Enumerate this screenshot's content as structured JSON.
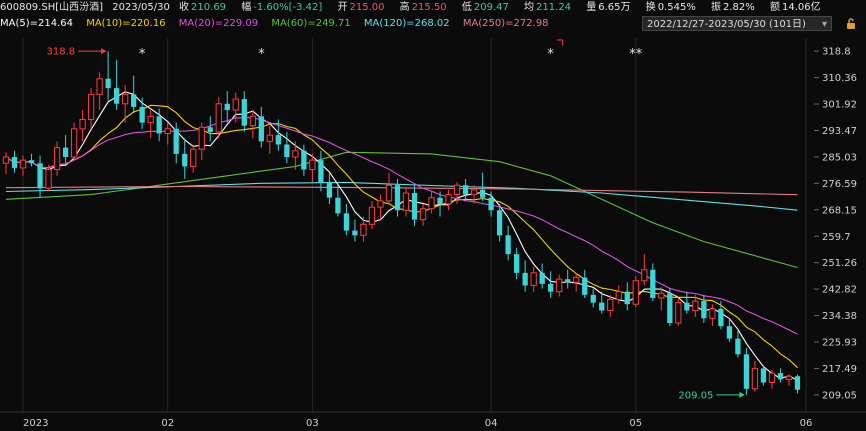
{
  "header": {
    "code": "600809.SH[山西汾酒]",
    "date": "2023/05/30",
    "close_label": "收",
    "close": "210.69",
    "chg_label": "幅",
    "chg": "-1.60%[-3.42]",
    "open_label": "开",
    "open": "215.00",
    "high_label": "高",
    "high": "215.50",
    "low_label": "低",
    "low": "209.47",
    "avg_label": "均",
    "avg": "211.24",
    "vol_label": "量",
    "vol": "6.65万",
    "turn_label": "换",
    "turn": "0.545%",
    "amp_label": "振",
    "amp": "2.82%",
    "amt_label": "额",
    "amt": "14.06亿"
  },
  "ma_legend": [
    {
      "label": "MA(5)=214.64",
      "color": "#ffffff"
    },
    {
      "label": "MA(10)=220.16",
      "color": "#f5d300"
    },
    {
      "label": "MA(20)=229.09",
      "color": "#e24fe6"
    },
    {
      "label": "MA(60)=249.71",
      "color": "#5cc23a"
    },
    {
      "label": "MA(120)=268.02",
      "color": "#61e0e6"
    },
    {
      "label": "MA(250)=272.98",
      "color": "#e87d7d"
    }
  ],
  "range_selector": {
    "label": "2022/12/27-2023/05/30 (101日)"
  },
  "chart_data": {
    "type": "candlestick",
    "y_ticks": [
      "318.8",
      "310.36",
      "301.92",
      "293.47",
      "285.03",
      "276.59",
      "268.15",
      "259.7",
      "251.26",
      "242.82",
      "234.38",
      "225.93",
      "217.49",
      "209.05"
    ],
    "ylim": [
      205.5,
      323.0
    ],
    "x_labels": [
      {
        "label": "2023",
        "i": 2
      },
      {
        "label": "02",
        "i": 19
      },
      {
        "label": "03",
        "i": 36
      },
      {
        "label": "04",
        "i": 57
      },
      {
        "label": "05",
        "i": 74
      },
      {
        "label": "06",
        "i": 94
      }
    ],
    "annotations": [
      {
        "text": "318.8",
        "i": 12,
        "price": 318.8,
        "side": "left",
        "color": "#ff4040"
      },
      {
        "text": "209.05",
        "i": 87,
        "price": 209.05,
        "side": "left",
        "color": "#3bd08c"
      }
    ],
    "markers": [
      {
        "text": "*",
        "i": 16
      },
      {
        "text": "*",
        "i": 30
      },
      {
        "text": "*",
        "i": 64
      },
      {
        "text": "**",
        "i": 74
      }
    ],
    "candles": [
      {
        "o": 283.0,
        "h": 286.5,
        "l": 279.5,
        "c": 285.0
      },
      {
        "o": 285.0,
        "h": 287.0,
        "l": 280.0,
        "c": 281.5
      },
      {
        "o": 281.5,
        "h": 285.5,
        "l": 279.0,
        "c": 284.0
      },
      {
        "o": 284.0,
        "h": 286.0,
        "l": 282.0,
        "c": 283.0
      },
      {
        "o": 283.0,
        "h": 285.5,
        "l": 272.0,
        "c": 275.0
      },
      {
        "o": 275.0,
        "h": 282.5,
        "l": 274.0,
        "c": 281.0
      },
      {
        "o": 281.0,
        "h": 290.0,
        "l": 279.0,
        "c": 288.0
      },
      {
        "o": 288.0,
        "h": 292.0,
        "l": 283.0,
        "c": 285.0
      },
      {
        "o": 285.0,
        "h": 296.0,
        "l": 284.0,
        "c": 294.0
      },
      {
        "o": 294.0,
        "h": 300.0,
        "l": 290.0,
        "c": 297.0
      },
      {
        "o": 297.0,
        "h": 307.0,
        "l": 294.0,
        "c": 305.0
      },
      {
        "o": 305.0,
        "h": 312.0,
        "l": 300.0,
        "c": 310.0
      },
      {
        "o": 310.0,
        "h": 318.8,
        "l": 303.0,
        "c": 307.0
      },
      {
        "o": 307.0,
        "h": 316.0,
        "l": 300.0,
        "c": 302.0
      },
      {
        "o": 302.0,
        "h": 308.0,
        "l": 296.0,
        "c": 305.0
      },
      {
        "o": 305.0,
        "h": 311.0,
        "l": 299.0,
        "c": 301.0
      },
      {
        "o": 301.0,
        "h": 304.0,
        "l": 294.0,
        "c": 296.0
      },
      {
        "o": 296.0,
        "h": 300.0,
        "l": 291.0,
        "c": 298.0
      },
      {
        "o": 298.0,
        "h": 300.5,
        "l": 290.0,
        "c": 292.5
      },
      {
        "o": 292.5,
        "h": 296.0,
        "l": 289.0,
        "c": 294.0
      },
      {
        "o": 294.0,
        "h": 296.0,
        "l": 283.0,
        "c": 286.0
      },
      {
        "o": 286.0,
        "h": 291.0,
        "l": 278.0,
        "c": 282.0
      },
      {
        "o": 282.0,
        "h": 289.0,
        "l": 280.0,
        "c": 287.5
      },
      {
        "o": 287.5,
        "h": 296.0,
        "l": 284.0,
        "c": 294.5
      },
      {
        "o": 294.5,
        "h": 298.0,
        "l": 290.0,
        "c": 293.0
      },
      {
        "o": 293.0,
        "h": 304.0,
        "l": 291.0,
        "c": 302.0
      },
      {
        "o": 302.0,
        "h": 306.0,
        "l": 296.0,
        "c": 300.0
      },
      {
        "o": 300.0,
        "h": 305.5,
        "l": 296.0,
        "c": 303.5
      },
      {
        "o": 303.5,
        "h": 306.0,
        "l": 293.0,
        "c": 295.0
      },
      {
        "o": 295.0,
        "h": 300.0,
        "l": 291.0,
        "c": 298.0
      },
      {
        "o": 298.0,
        "h": 301.0,
        "l": 288.0,
        "c": 290.0
      },
      {
        "o": 290.0,
        "h": 295.0,
        "l": 286.0,
        "c": 292.0
      },
      {
        "o": 292.0,
        "h": 297.0,
        "l": 287.0,
        "c": 289.0
      },
      {
        "o": 289.0,
        "h": 293.0,
        "l": 283.0,
        "c": 285.0
      },
      {
        "o": 285.0,
        "h": 290.0,
        "l": 281.0,
        "c": 287.0
      },
      {
        "o": 287.0,
        "h": 289.0,
        "l": 279.0,
        "c": 281.0
      },
      {
        "o": 281.0,
        "h": 286.0,
        "l": 277.0,
        "c": 284.0
      },
      {
        "o": 284.0,
        "h": 287.0,
        "l": 274.0,
        "c": 277.0
      },
      {
        "o": 277.0,
        "h": 280.0,
        "l": 270.0,
        "c": 272.0
      },
      {
        "o": 272.0,
        "h": 276.0,
        "l": 266.0,
        "c": 267.0
      },
      {
        "o": 267.0,
        "h": 270.0,
        "l": 260.0,
        "c": 261.5
      },
      {
        "o": 261.5,
        "h": 265.0,
        "l": 258.0,
        "c": 260.0
      },
      {
        "o": 260.0,
        "h": 266.0,
        "l": 258.0,
        "c": 263.5
      },
      {
        "o": 263.5,
        "h": 271.0,
        "l": 262.0,
        "c": 269.0
      },
      {
        "o": 269.0,
        "h": 273.0,
        "l": 265.0,
        "c": 271.0
      },
      {
        "o": 271.0,
        "h": 280.0,
        "l": 270.0,
        "c": 276.0
      },
      {
        "o": 276.0,
        "h": 278.0,
        "l": 266.0,
        "c": 268.0
      },
      {
        "o": 268.0,
        "h": 275.0,
        "l": 266.0,
        "c": 273.5
      },
      {
        "o": 273.5,
        "h": 276.0,
        "l": 263.0,
        "c": 265.0
      },
      {
        "o": 265.0,
        "h": 270.0,
        "l": 263.0,
        "c": 268.5
      },
      {
        "o": 268.5,
        "h": 274.0,
        "l": 267.0,
        "c": 272.0
      },
      {
        "o": 272.0,
        "h": 274.0,
        "l": 266.0,
        "c": 270.0
      },
      {
        "o": 270.0,
        "h": 274.5,
        "l": 268.0,
        "c": 273.0
      },
      {
        "o": 273.0,
        "h": 277.0,
        "l": 270.0,
        "c": 276.0
      },
      {
        "o": 276.0,
        "h": 278.0,
        "l": 271.0,
        "c": 273.0
      },
      {
        "o": 273.0,
        "h": 276.0,
        "l": 270.0,
        "c": 274.5
      },
      {
        "o": 274.5,
        "h": 280.0,
        "l": 271.0,
        "c": 272.0
      },
      {
        "o": 272.0,
        "h": 274.0,
        "l": 266.0,
        "c": 268.0
      },
      {
        "o": 268.0,
        "h": 270.0,
        "l": 258.0,
        "c": 260.0
      },
      {
        "o": 260.0,
        "h": 263.0,
        "l": 252.0,
        "c": 254.0
      },
      {
        "o": 254.0,
        "h": 256.0,
        "l": 246.0,
        "c": 248.0
      },
      {
        "o": 248.0,
        "h": 252.0,
        "l": 242.0,
        "c": 244.0
      },
      {
        "o": 244.0,
        "h": 250.0,
        "l": 242.0,
        "c": 248.0
      },
      {
        "o": 248.0,
        "h": 251.0,
        "l": 243.0,
        "c": 244.5
      },
      {
        "o": 244.5,
        "h": 248.5,
        "l": 240.0,
        "c": 242.0
      },
      {
        "o": 242.0,
        "h": 247.5,
        "l": 240.5,
        "c": 246.0
      },
      {
        "o": 246.0,
        "h": 249.0,
        "l": 243.0,
        "c": 245.0
      },
      {
        "o": 245.0,
        "h": 248.0,
        "l": 242.0,
        "c": 246.5
      },
      {
        "o": 246.5,
        "h": 249.0,
        "l": 240.0,
        "c": 241.0
      },
      {
        "o": 241.0,
        "h": 243.0,
        "l": 237.0,
        "c": 238.5
      },
      {
        "o": 238.5,
        "h": 242.0,
        "l": 235.0,
        "c": 236.0
      },
      {
        "o": 236.0,
        "h": 241.0,
        "l": 234.0,
        "c": 239.5
      },
      {
        "o": 239.5,
        "h": 244.0,
        "l": 238.0,
        "c": 242.0
      },
      {
        "o": 242.0,
        "h": 245.0,
        "l": 236.0,
        "c": 238.0
      },
      {
        "o": 238.0,
        "h": 247.0,
        "l": 237.0,
        "c": 245.5
      },
      {
        "o": 245.5,
        "h": 254.0,
        "l": 244.0,
        "c": 249.0
      },
      {
        "o": 249.0,
        "h": 251.0,
        "l": 239.0,
        "c": 240.0
      },
      {
        "o": 240.0,
        "h": 243.5,
        "l": 236.0,
        "c": 241.5
      },
      {
        "o": 241.5,
        "h": 243.0,
        "l": 231.0,
        "c": 232.0
      },
      {
        "o": 232.0,
        "h": 240.0,
        "l": 231.0,
        "c": 238.5
      },
      {
        "o": 238.5,
        "h": 242.0,
        "l": 235.0,
        "c": 236.0
      },
      {
        "o": 236.0,
        "h": 241.0,
        "l": 234.0,
        "c": 239.0
      },
      {
        "o": 239.0,
        "h": 241.0,
        "l": 232.0,
        "c": 233.5
      },
      {
        "o": 233.5,
        "h": 238.0,
        "l": 231.0,
        "c": 236.5
      },
      {
        "o": 236.5,
        "h": 239.0,
        "l": 230.0,
        "c": 231.0
      },
      {
        "o": 231.0,
        "h": 233.0,
        "l": 226.0,
        "c": 227.0
      },
      {
        "o": 227.0,
        "h": 229.5,
        "l": 221.0,
        "c": 222.0
      },
      {
        "o": 222.0,
        "h": 224.0,
        "l": 209.05,
        "c": 211.0
      },
      {
        "o": 211.0,
        "h": 220.0,
        "l": 210.0,
        "c": 217.5
      },
      {
        "o": 217.5,
        "h": 218.5,
        "l": 212.0,
        "c": 213.0
      },
      {
        "o": 213.0,
        "h": 217.0,
        "l": 211.0,
        "c": 216.0
      },
      {
        "o": 216.0,
        "h": 217.5,
        "l": 213.0,
        "c": 214.0
      },
      {
        "o": 214.0,
        "h": 215.5,
        "l": 212.0,
        "c": 215.0
      },
      {
        "o": 215.0,
        "h": 215.5,
        "l": 209.47,
        "c": 210.69
      }
    ],
    "long_ma": [
      {
        "name": "MA(60)",
        "points": [
          [
            0,
            271.5
          ],
          [
            10,
            273.0
          ],
          [
            18,
            276.0
          ],
          [
            26,
            279.0
          ],
          [
            34,
            282.0
          ],
          [
            40,
            286.5
          ],
          [
            50,
            286.0
          ],
          [
            58,
            283.5
          ],
          [
            64,
            279.0
          ],
          [
            70,
            271.5
          ],
          [
            76,
            264.0
          ],
          [
            82,
            258.0
          ],
          [
            88,
            253.5
          ],
          [
            93,
            249.71
          ]
        ]
      },
      {
        "name": "MA(120)",
        "points": [
          [
            0,
            274.0
          ],
          [
            10,
            274.6
          ],
          [
            20,
            275.6
          ],
          [
            30,
            276.6
          ],
          [
            40,
            276.9
          ],
          [
            50,
            275.9
          ],
          [
            60,
            275.0
          ],
          [
            70,
            273.5
          ],
          [
            80,
            271.2
          ],
          [
            88,
            269.4
          ],
          [
            93,
            268.02
          ]
        ]
      },
      {
        "name": "MA(250)",
        "points": [
          [
            0,
            275.2
          ],
          [
            20,
            275.6
          ],
          [
            40,
            275.3
          ],
          [
            60,
            274.8
          ],
          [
            80,
            273.8
          ],
          [
            93,
            272.98
          ]
        ]
      }
    ],
    "grid": false
  }
}
